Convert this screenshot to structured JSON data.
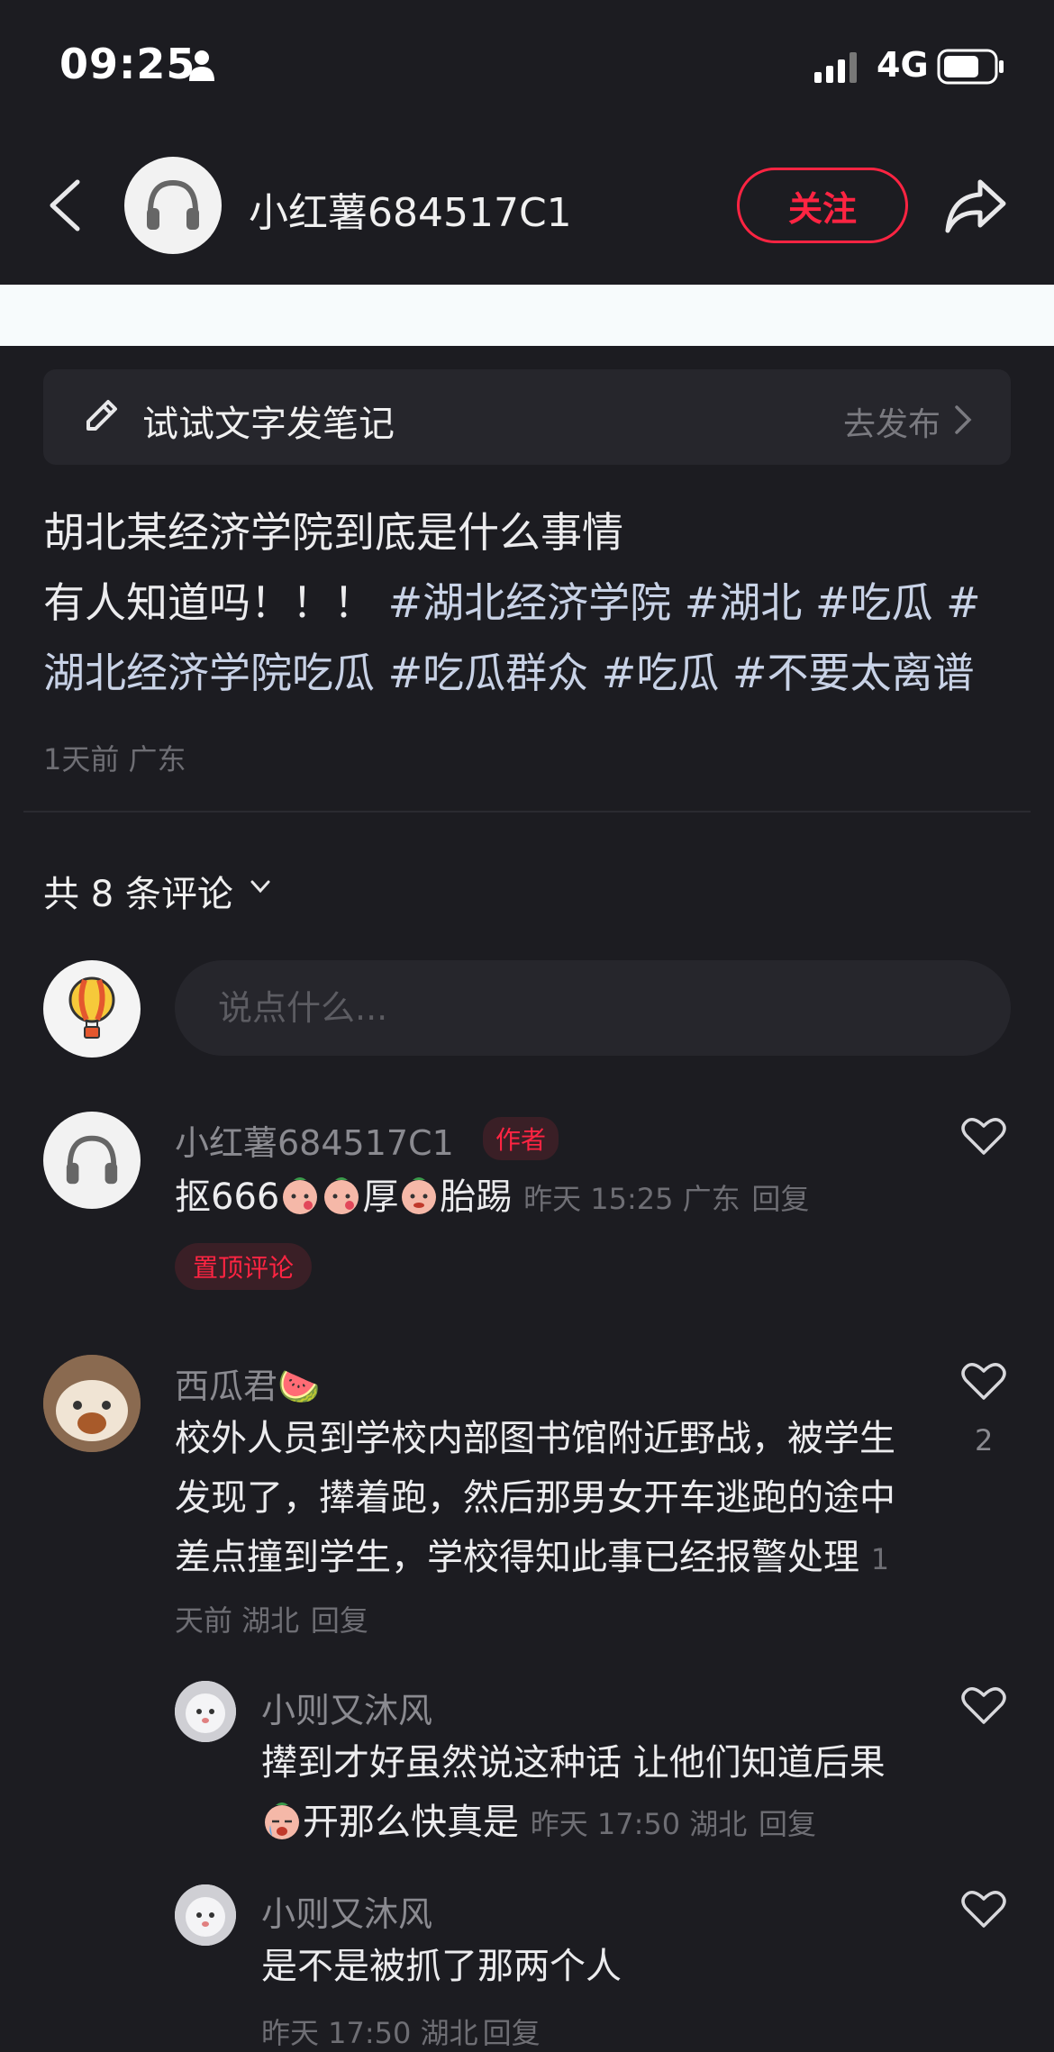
{
  "status_bar": {
    "time": "09:25",
    "network": "4G"
  },
  "header": {
    "username": "小红薯684517C1",
    "follow_label": "关注"
  },
  "draft_bar": {
    "label": "试试文字发笔记",
    "publish_label": "去发布"
  },
  "post": {
    "line1": "胡北某经济学院到底是什么事情",
    "line2_plain": "有人知道吗！！！",
    "tags": [
      "#湖北经济学院",
      "#湖北",
      "#吃瓜",
      "#湖北经济学院吃瓜",
      "#吃瓜群众",
      "#吃瓜",
      "#不要太离谱"
    ],
    "meta": "1天前 广东"
  },
  "comments_header": {
    "label": "共 8 条评论"
  },
  "comment_input": {
    "placeholder": "说点什么..."
  },
  "comments": [
    {
      "name": "小红薯684517C1",
      "badge": "作者",
      "text_parts": [
        "抠666",
        "厚",
        "胎踢"
      ],
      "meta": "昨天 15:25 广东",
      "reply_label": "回复",
      "pinned_label": "置顶评论"
    },
    {
      "name": "西瓜君🍉",
      "text": "校外人员到学校内部图书馆附近野战，被学生发现了，撵着跑，然后那男女开车逃跑的途中差点撞到学生，学校得知此事已经报警处理",
      "meta": "1天前 湖北",
      "reply_label": "回复",
      "likes": "2"
    },
    {
      "name": "小则又沐风",
      "text_line1": "撵到才好虽然说这种话 让他们知道后果",
      "text_line2": "开那么快真是",
      "meta": "昨天 17:50 湖北",
      "reply_label": "回复"
    },
    {
      "name": "小则又沐风",
      "text": "是不是被抓了那两个人",
      "meta": "昨天 17:50 湖北",
      "reply_label": "回复"
    }
  ],
  "colors": {
    "accent": "#ff2442",
    "background": "#1c1c21",
    "hashtag": "#c8d2e6"
  },
  "icons": [
    "person-icon",
    "signal-icon",
    "battery-icon",
    "back-icon",
    "headphones-icon",
    "share-icon",
    "pencil-icon",
    "chevron-right-icon",
    "chevron-down-icon",
    "balloon-icon",
    "heart-icon",
    "blush-emoji-icon",
    "crying-emoji-icon"
  ]
}
